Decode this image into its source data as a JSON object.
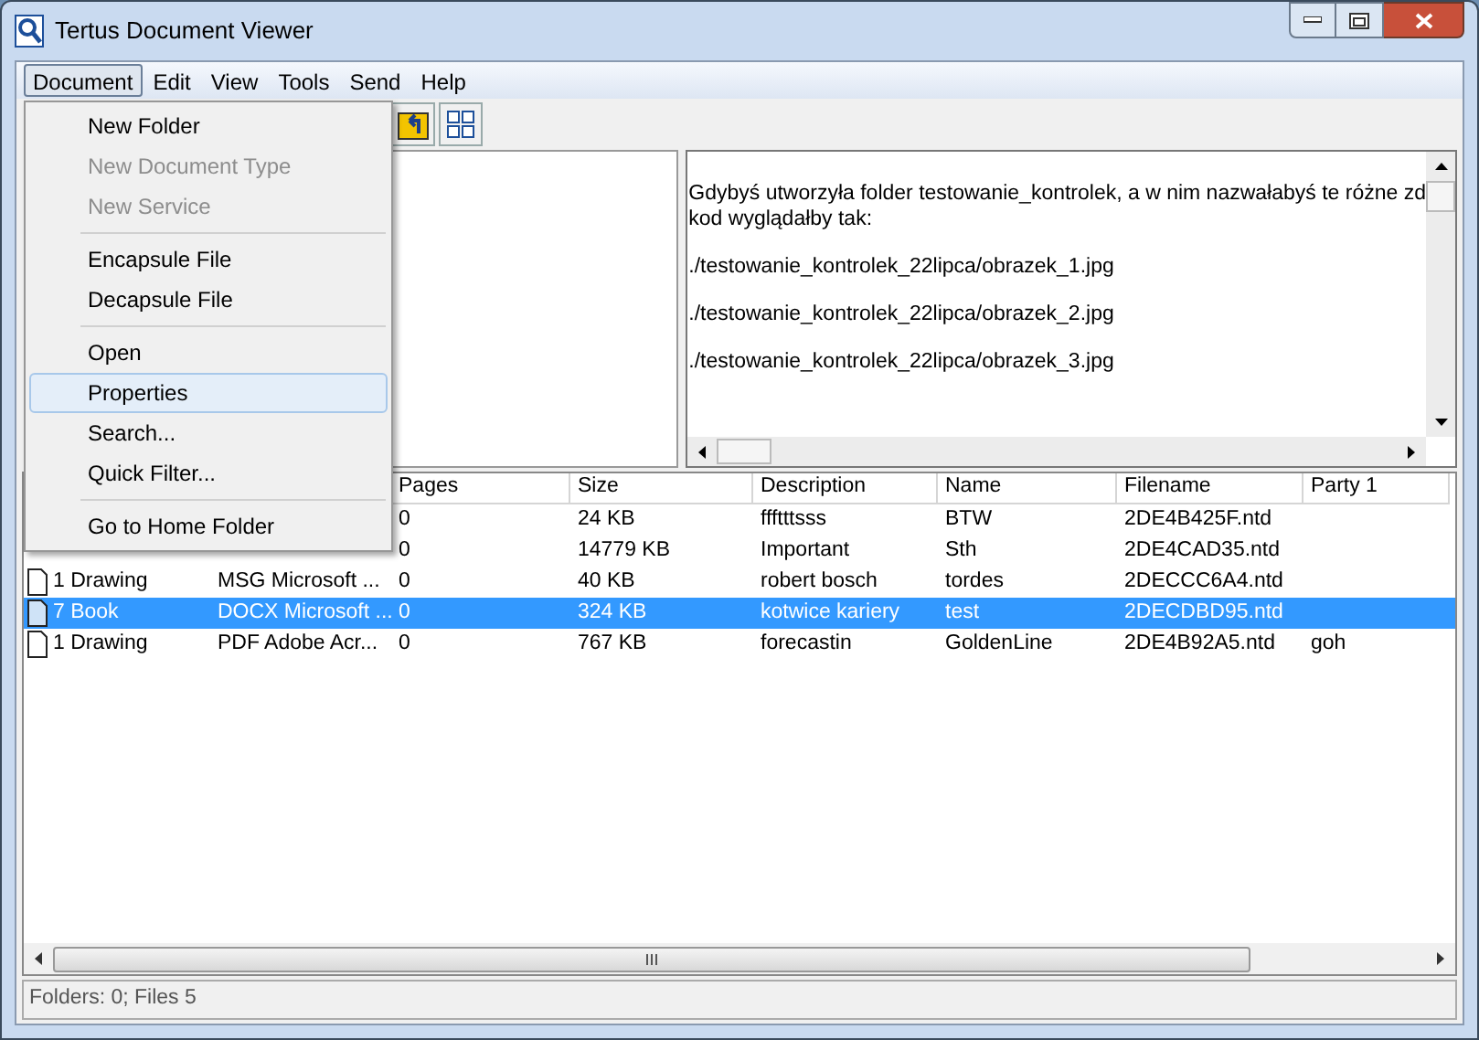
{
  "window": {
    "title": "Tertus Document Viewer"
  },
  "menu_bar": [
    {
      "label": "Document",
      "selected": true
    },
    {
      "label": "Edit",
      "selected": false
    },
    {
      "label": "View",
      "selected": false
    },
    {
      "label": "Tools",
      "selected": false
    },
    {
      "label": "Send",
      "selected": false
    },
    {
      "label": "Help",
      "selected": false
    }
  ],
  "open_menu": {
    "items": [
      {
        "kind": "item",
        "label": "New Folder",
        "disabled": false,
        "selected": false
      },
      {
        "kind": "item",
        "label": "New Document Type",
        "disabled": true,
        "selected": false
      },
      {
        "kind": "item",
        "label": "New Service",
        "disabled": true,
        "selected": false
      },
      {
        "kind": "separator"
      },
      {
        "kind": "item",
        "label": "Encapsule File",
        "disabled": false,
        "selected": false
      },
      {
        "kind": "item",
        "label": "Decapsule File",
        "disabled": false,
        "selected": false
      },
      {
        "kind": "separator"
      },
      {
        "kind": "item",
        "label": "Open",
        "disabled": false,
        "selected": false
      },
      {
        "kind": "item",
        "label": "Properties",
        "disabled": false,
        "selected": true
      },
      {
        "kind": "item",
        "label": "Search...",
        "disabled": false,
        "selected": false
      },
      {
        "kind": "item",
        "label": "Quick Filter...",
        "disabled": false,
        "selected": false
      },
      {
        "kind": "separator"
      },
      {
        "kind": "item",
        "label": "Go to Home Folder",
        "disabled": false,
        "selected": false
      }
    ]
  },
  "preview": {
    "paragraphs": [
      "Gdybyś utworzyła folder testowanie_kontrolek, a w nim nazwałabyś te różne zd",
      "kod wyglądałby tak:",
      "./testowanie_kontrolek_22lipca/obrazek_1.jpg",
      "./testowanie_kontrolek_22lipca/obrazek_2.jpg",
      "./testowanie_kontrolek_22lipca/obrazek_3.jpg"
    ]
  },
  "table": {
    "columns": [
      "",
      "",
      "Pages",
      "Size",
      "Description",
      "Name",
      "Filename",
      "Party 1"
    ],
    "rows": [
      {
        "selected": false,
        "cells": [
          "",
          "",
          "0",
          "24 KB",
          "ffftttsss",
          "BTW",
          "2DE4B425F.ntd",
          ""
        ]
      },
      {
        "selected": false,
        "cells": [
          "",
          "",
          "0",
          "14779 KB",
          "Important",
          "Sth",
          "2DE4CAD35.ntd",
          ""
        ]
      },
      {
        "selected": false,
        "cells": [
          "1 Drawing",
          "MSG Microsoft ...",
          "0",
          "40 KB",
          "robert bosch",
          "tordes",
          "2DECCC6A4.ntd",
          ""
        ]
      },
      {
        "selected": true,
        "cells": [
          "7 Book",
          "DOCX Microsoft ...",
          "0",
          "324 KB",
          "kotwice kariery",
          "test",
          "2DECDBD95.ntd",
          ""
        ]
      },
      {
        "selected": false,
        "cells": [
          "1 Drawing",
          "PDF Adobe Acr...",
          "0",
          "767 KB",
          "forecastin",
          "GoldenLine",
          "2DE4B92A5.ntd",
          "goh"
        ]
      }
    ]
  },
  "status_bar": "Folders: 0; Files 5"
}
